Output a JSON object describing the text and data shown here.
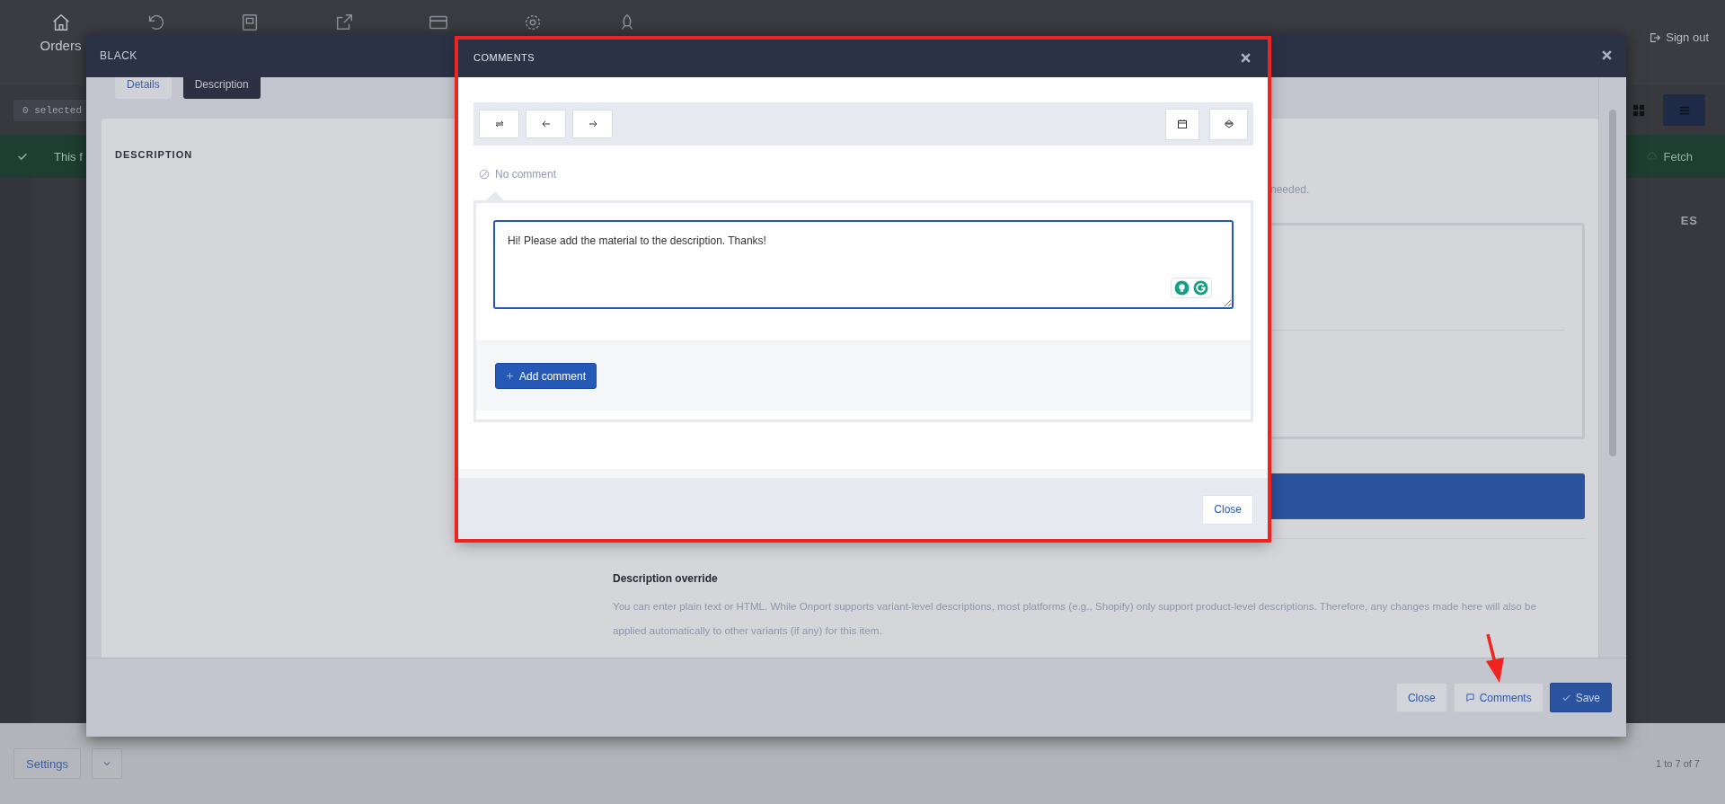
{
  "top_nav": {
    "item_label": "Orders",
    "sign_out": "Sign out"
  },
  "background": {
    "selection_badge": "0 selected",
    "banner_text": "This f",
    "fetch_button": "Fetch",
    "column_heading": "ES",
    "settings_button": "Settings",
    "pager": "1 to 7 of 7"
  },
  "item_modal": {
    "title": "BLACK",
    "tabs": [
      {
        "label": "Details",
        "selected": false
      },
      {
        "label": "Description",
        "selected": true
      }
    ],
    "section_heading": "DESCRIPTION",
    "hint_tail": "needed.",
    "override_heading": "Description override",
    "override_text": "You can enter plain text or HTML. While Onport supports variant-level descriptions, most platforms (e.g., Shopify) only support product-level descriptions. Therefore, any changes made here will also be applied automatically to other variants (if any) for this item.",
    "buttons": [
      {
        "label": "Close",
        "kind": "secondary"
      },
      {
        "label": "Comments",
        "kind": "comments"
      },
      {
        "label": "Save",
        "kind": "primary"
      }
    ]
  },
  "comments_modal": {
    "title": "COMMENTS",
    "status": "No comment",
    "comment_value": "Hi! Please add the material to the description. Thanks!",
    "add_button": "Add comment",
    "close_button": "Close"
  }
}
